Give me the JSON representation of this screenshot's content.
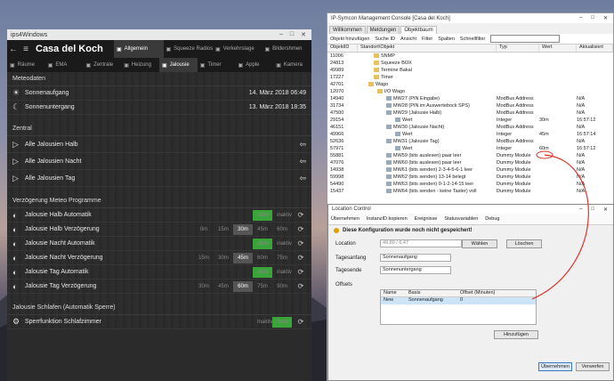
{
  "ips": {
    "window_title": "ips4Windows",
    "app_title": "Casa del Koch",
    "tabs_row1": [
      {
        "label": "Allgemein",
        "active": true
      },
      {
        "label": "Squeeze Radios",
        "active": false
      },
      {
        "label": "Verkehrslage",
        "active": false
      },
      {
        "label": "Bildershmen",
        "active": false
      }
    ],
    "tabs_row2": [
      {
        "label": "Räume",
        "active": false
      },
      {
        "label": "EMA",
        "active": false
      },
      {
        "label": "Zentrale",
        "active": false
      },
      {
        "label": "Heizung",
        "active": false
      },
      {
        "label": "Jalousie",
        "active": true
      },
      {
        "label": "Timer",
        "active": false
      },
      {
        "label": "Apple",
        "active": false
      },
      {
        "label": "Kamera",
        "active": false
      }
    ],
    "meteo": {
      "heading": "Meteodaten",
      "rows": [
        {
          "label": "Sonnenaufgang",
          "value": "14. März 2018 06:49"
        },
        {
          "label": "Sonnenuntergang",
          "value": "13. März 2018 18:35"
        }
      ]
    },
    "zentral": {
      "heading": "Zentral",
      "rows": [
        {
          "label": "Alle Jalousien Halb"
        },
        {
          "label": "Alle Jalousien Nacht"
        },
        {
          "label": "Alle Jalousien Tag"
        }
      ]
    },
    "verz": {
      "heading": "Verzögerung Meteo Programme",
      "rows": [
        {
          "label": "Jalousie Halb Automatik",
          "type": "toggle",
          "on": "Aktiv",
          "off": "inaktiv"
        },
        {
          "label": "Jalousie Halb Verzögerung",
          "type": "seg",
          "opts": [
            "0m",
            "15m",
            "30m",
            "45m",
            "60m"
          ],
          "sel": 2
        },
        {
          "label": "Jalousie Nacht Automatik",
          "type": "toggle",
          "on": "Aktiv",
          "off": "inaktiv"
        },
        {
          "label": "Jalousie Nacht Verzögerung",
          "type": "seg",
          "opts": [
            "15m",
            "30m",
            "45m",
            "60m",
            "75m"
          ],
          "sel": 2
        },
        {
          "label": "Jalousie Tag Automatik",
          "type": "toggle",
          "on": "Aktiv",
          "off": "inaktiv"
        },
        {
          "label": "Jalousie Tag Verzögerung",
          "type": "seg",
          "opts": [
            "30m",
            "45m",
            "60m",
            "75m",
            "90m"
          ],
          "sel": 2
        }
      ]
    },
    "schlafen": {
      "heading": "Jalousie Schlafen (Automatik Sperre)",
      "rows": [
        {
          "label": "Sperrfunktion Schlafzimmer",
          "on": "Aktiv",
          "off": "Inaktiv"
        }
      ]
    }
  },
  "sym": {
    "window_title": "IP-Symcon Management Console [Casa del Koch]",
    "tabs": [
      "Willkommen",
      "Meldungen",
      "Objektbaum"
    ],
    "tools": [
      "Objekt hinzufügen",
      "Suche ID",
      "Ansicht",
      "Filter",
      "Spalten",
      "Schnellfilter"
    ],
    "cols": [
      "ObjektID",
      "Standort\\Objekt",
      "Typ",
      "Wert",
      "Aktualisiert"
    ],
    "rows": [
      [
        "11006",
        "SNMP",
        "",
        "",
        ""
      ],
      [
        "24813",
        "Squeeze BOX",
        "",
        "",
        ""
      ],
      [
        "49989",
        "Termine Bakal",
        "",
        "",
        ""
      ],
      [
        "17227",
        "Timer",
        "",
        "",
        ""
      ],
      [
        "42701",
        "Wago",
        "",
        "",
        ""
      ],
      [
        "12070",
        "I/O Wago",
        "",
        "",
        ""
      ],
      [
        "14940",
        "MW27 (PIN Eingabe)",
        "ModBus Address",
        "",
        "N/A"
      ],
      [
        "31734",
        "MW28 (PIN im Auswertebock SPS)",
        "ModBus Address",
        "",
        "N/A"
      ],
      [
        "47500",
        "MW29 (Jalousie Halb)",
        "ModBus Address",
        "",
        "N/A"
      ],
      [
        "29154",
        "Wert",
        "Integer",
        "30m",
        "16:57:12"
      ],
      [
        "46151",
        "MW30 (Jalousie Nacht)",
        "ModBus Address",
        "",
        "N/A"
      ],
      [
        "49966",
        "Wert",
        "Integer",
        "45m",
        "16:57:14"
      ],
      [
        "52636",
        "MW31 (Jalousie Tag)",
        "ModBus Address",
        "",
        "N/A"
      ],
      [
        "57971",
        "Wert",
        "Integer",
        "60m",
        "16:57:12"
      ],
      [
        "55881",
        "MW59 (bits auslesen) paar leer",
        "Dummy Module",
        "",
        "N/A"
      ],
      [
        "47076",
        "MW60 (bits auslesen) paar leer",
        "Dummy Module",
        "",
        "N/A"
      ],
      [
        "14938",
        "MW61 (bits senden) 2-3-4-5-6-1 leer",
        "Dummy Module",
        "",
        "N/A"
      ],
      [
        "59998",
        "MW62 (bits senden) 13-14 belegt",
        "Dummy Module",
        "",
        "N/A"
      ],
      [
        "54490",
        "MW63 (bits senden) 0-1-2-14-15 leer",
        "Dummy Module",
        "",
        "N/A"
      ],
      [
        "15437",
        "MW64 (bits senden - keine Taster) voll",
        "Dummy Module",
        "",
        "N/A"
      ]
    ]
  },
  "loc": {
    "window_title": "Location Control",
    "tools": [
      "Übernehmen",
      "InstanzID kopieren",
      "Ereignisse",
      "Statusvariablen",
      "Debug"
    ],
    "warning": "Diese Konfiguration wurde noch nicht gespeichert!",
    "location_label": "Location",
    "location_value": "49,89 / 6,47",
    "choose": "Wählen",
    "delete": "Löschen",
    "tagesanfang_label": "Tagesanfang",
    "tagesanfang_value": "Sonnenaufgang",
    "tagesende_label": "Tagesende",
    "tagesende_value": "Sonnenuntergang",
    "offsets_label": "Offsets",
    "grid_cols": [
      "Name",
      "Basis",
      "Offset (Minuten)"
    ],
    "grid_row": [
      "New",
      "Sonnenaufgang",
      "0"
    ],
    "add": "Hinzufügen",
    "apply": "Übernehmen",
    "discard": "Verwerfen"
  },
  "colors": {
    "accent": "#3aa33a",
    "annotation": "#d9342b"
  }
}
